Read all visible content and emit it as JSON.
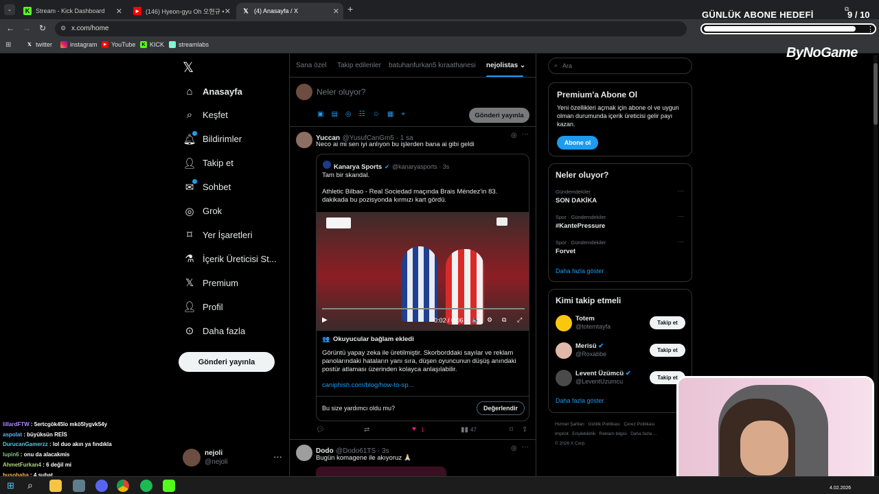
{
  "browser": {
    "tabs": [
      {
        "label": "Stream - Kick Dashboard",
        "icon": "kick-icon"
      },
      {
        "label": "(146) Hyeon-gyu Oh 오현규 •",
        "icon": "youtube-icon"
      },
      {
        "label": "(4) Anasayfa / X",
        "icon": "x-icon"
      }
    ],
    "url": "x.com/home",
    "bookmarks": [
      "twitter",
      "instagram",
      "YouTube",
      "KICK",
      "streamlabs"
    ]
  },
  "overlay": {
    "goal_title": "GÜNLÜK ABONE HEDEFİ",
    "goal_count": "9 / 10",
    "goal_progress": 0.9,
    "sponsor": "ByNoGame"
  },
  "nav": {
    "items": [
      {
        "label": "Anasayfa",
        "icon": "home-icon",
        "bold": true
      },
      {
        "label": "Keşfet",
        "icon": "search-icon"
      },
      {
        "label": "Bildirimler",
        "icon": "bell-icon",
        "badge": true
      },
      {
        "label": "Takip et",
        "icon": "add-user-icon"
      },
      {
        "label": "Sohbet",
        "icon": "mail-icon",
        "badge": true
      },
      {
        "label": "Grok",
        "icon": "grok-icon"
      },
      {
        "label": "Yer İşaretleri",
        "icon": "bookmark-icon"
      },
      {
        "label": "İçerik Üreticisi St...",
        "icon": "flask-icon"
      },
      {
        "label": "Premium",
        "icon": "x-icon"
      },
      {
        "label": "Profil",
        "icon": "person-icon"
      },
      {
        "label": "Daha fazla",
        "icon": "more-circle-icon"
      }
    ],
    "post_button": "Gönderi yayınla",
    "account_name": "nejoli",
    "account_handle": "@nejoli"
  },
  "timeline": {
    "tabs": [
      "Sana özel",
      "Takip edilenler",
      "batuhanfurkan5 kıraathanesi",
      "nejolistas"
    ],
    "composer_placeholder": "Neler oluyor?",
    "composer_button": "Gönderi yayınla",
    "post1": {
      "name": "Yuccan",
      "handle": "@YusufCanGm5 · 1 sa",
      "text": "Neco ai mi sen iyi anlıyon bu işlerden bana ai gibi geldi",
      "quote": {
        "name": "Kanarya Sports",
        "handle": "@kanaryasports · 3s",
        "line1": "Tam bir skandal.",
        "line2": "Athletic Bilbao - Real Sociedad maçında Brais Méndez'in 83. dakikada bu pozisyonda kırmızı kart gördü.",
        "video_time": "0:02 / 0:06"
      },
      "community_note": {
        "title": "Okuyucular bağlam ekledi",
        "text": "Görüntü yapay zeka ile üretilmiştir. Skorborddaki sayılar ve reklam panolarındaki hataların yanı sıra, düşen oyuncunun düşüş anındaki postür atlaması üzerinden kolayca anlaşılabilir.",
        "link": "caniphish.com/blog/how-to-sp...",
        "question": "Bu size yardımcı oldu mu?",
        "rate_button": "Değerlendir"
      },
      "likes": "1",
      "views": "47"
    },
    "post2": {
      "name": "Dodo",
      "handle": "@Dodo61TS · 3s",
      "text": "Bugün komagene ile akıyoruz 🙏🏻"
    }
  },
  "sidebar": {
    "search_placeholder": "Ara",
    "premium": {
      "title": "Premium'a Abone Ol",
      "text": "Yeni özellikleri açmak için abone ol ve uygun olman durumunda içerik üreticisi gelir payı kazan.",
      "button": "Abone ol"
    },
    "trends": {
      "title": "Neler oluyor?",
      "items": [
        {
          "category": "Gündemdekiler",
          "topic": "SON DAKİKA"
        },
        {
          "category": "Spor · Gündemdekiler",
          "topic": "#KantePressure"
        },
        {
          "category": "Spor · Gündemdekiler",
          "topic": "Forvet"
        }
      ],
      "more": "Daha fazla göster"
    },
    "follow": {
      "title": "Kimi takip etmeli",
      "items": [
        {
          "name": "Totem",
          "handle": "@totemtayfa",
          "verified": false
        },
        {
          "name": "Merisü",
          "handle": "@Roxabbe",
          "verified": true
        },
        {
          "name": "Levent Üzümcü",
          "handle": "@LeventUzumcu",
          "verified": true
        }
      ],
      "button": "Takip et",
      "more": "Daha fazla göster"
    },
    "footer": [
      "Hizmet Şartları",
      "Gizlilik Politikası",
      "Çerez Politikası",
      "Imprint",
      "Erişilebilirlik",
      "Reklam bilgisi",
      "Daha fazla ...",
      "© 2026 X Corp."
    ]
  },
  "chat": [
    {
      "user": "lillardFTW",
      "msg": "5ertcgök45lo mkö5lygvk54y",
      "color": "#b388ff"
    },
    {
      "user": "aspolat",
      "msg": "büyüksün REİS",
      "color": "#64b5f6"
    },
    {
      "user": "DurucanGamerzz",
      "msg": "lol duo akın ya fındıkla",
      "color": "#4dd0e1"
    },
    {
      "user": "lupin6",
      "msg": "onu da alacakmis",
      "color": "#81c784"
    },
    {
      "user": "AhmetFurkan4",
      "msg": "6 değil mi",
      "color": "#aed581"
    },
    {
      "user": "husobaba",
      "msg": "4 şubat",
      "color": "#ffb74d"
    }
  ],
  "taskbar": {
    "date": "4.02.2026"
  }
}
